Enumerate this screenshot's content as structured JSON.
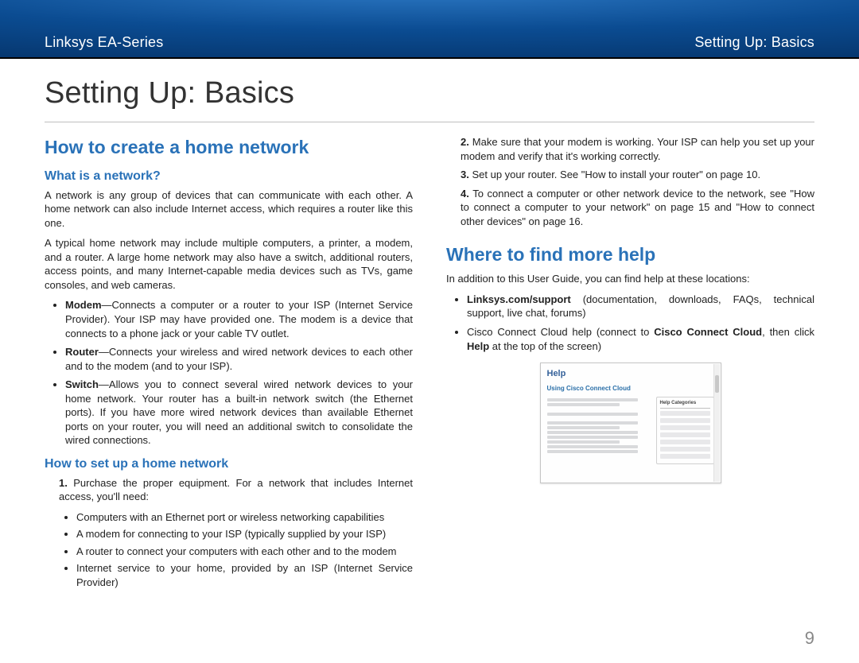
{
  "header": {
    "left": "Linksys EA-Series",
    "right": "Setting Up: Basics"
  },
  "title": "Setting Up: Basics",
  "left_col": {
    "h2": "How to create a home network",
    "sub1": "What is a network?",
    "p1": "A network is any group of devices that can communicate with each other. A home network can also include Internet access, which requires a router like this one.",
    "p2": "A typical home network may include multiple computers, a printer, a modem, and a router. A large home network may also have a switch, additional routers, access points, and many Internet-capable media devices such as TVs, game consoles, and web cameras.",
    "bullets": [
      {
        "b": "Modem",
        "t": "—Connects a computer or a router to your ISP (Internet Service Provider). Your ISP may have provided one. The modem is a device that connects to a phone jack or your cable TV outlet."
      },
      {
        "b": "Router",
        "t": "—Connects your wireless and wired network devices to each other and to the modem (and to your ISP)."
      },
      {
        "b": "Switch",
        "t": "—Allows you to connect several wired network devices to your home network. Your router has a built-in network switch (the Ethernet ports). If you have more wired network devices than available Ethernet ports on your router, you will need an additional switch to consolidate the wired connections."
      }
    ],
    "sub2": "How to set up a home network",
    "ol1": {
      "n": "1.",
      "t": "Purchase the proper equipment. For a network that includes Internet access, you'll need:"
    },
    "sub_bullets": [
      "Computers with an Ethernet port or wireless networking capabilities",
      "A modem for connecting to your ISP (typically supplied by your ISP)",
      "A router to connect your computers with each other and to the modem",
      "Internet service to your home, provided by an ISP (Internet Service Provider)"
    ]
  },
  "right_col": {
    "ol": [
      {
        "n": "2.",
        "t": "Make sure that your modem is working. Your ISP can help you set up your modem and verify that it's working correctly."
      },
      {
        "n": "3.",
        "t": "Set up your router. See \"How to install your router\" on page 10."
      },
      {
        "n": "4.",
        "t": "To connect a computer or other network device to the network, see \"How to connect a computer to your network\" on page 15 and \"How to connect other devices\" on page 16."
      }
    ],
    "h2": "Where to find more help",
    "p1": "In addition to this User Guide, you can find help at these locations:",
    "bullets": [
      {
        "pre": "",
        "b": "Linksys.com/support",
        "post": " (documentation, downloads, FAQs, technical support, live chat, forums)"
      },
      {
        "pre": "Cisco Connect Cloud help (connect to ",
        "b": "Cisco Connect Cloud",
        "post": ", then click ",
        "b2": "Help",
        "post2": " at the top of the screen)"
      }
    ],
    "help_shot": {
      "title": "Help",
      "sub": "Using Cisco Connect Cloud",
      "cat": "Help Categories"
    }
  },
  "page_number": "9"
}
